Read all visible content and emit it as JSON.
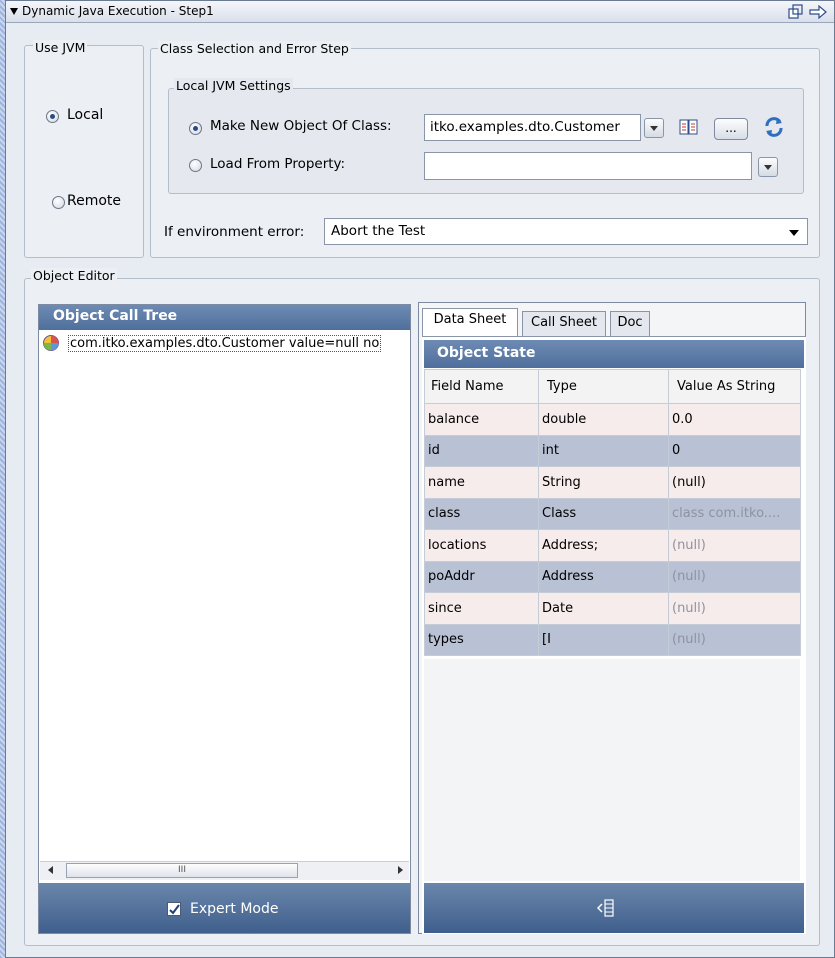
{
  "window": {
    "title": "Dynamic Java Execution - Step1"
  },
  "use_jvm": {
    "label": "Use JVM",
    "local_label": "Local",
    "remote_label": "Remote",
    "selected": "Local"
  },
  "class_selection": {
    "label": "Class Selection and Error Step",
    "local_jvm_settings": {
      "label": "Local JVM Settings",
      "make_new_label": "Make New Object Of Class:",
      "make_new_value": "itko.examples.dto.Customer",
      "load_from_label": "Load From Property:",
      "load_from_value": "",
      "ellipsis_label": "...",
      "selected": "Make New Object Of Class:"
    },
    "env_error_label": "If environment error:",
    "env_error_value": "Abort the Test"
  },
  "object_editor": {
    "label": "Object Editor",
    "call_tree": {
      "header": "Object Call Tree",
      "items": [
        "com.itko.examples.dto.Customer value=null no"
      ],
      "expert_mode_label": "Expert Mode",
      "expert_mode_checked": true
    },
    "tabs": [
      {
        "label": "Data Sheet",
        "selected": true
      },
      {
        "label": "Call Sheet"
      },
      {
        "label": "Doc"
      }
    ],
    "object_state": {
      "header": "Object State",
      "columns": [
        "Field Name",
        "Type",
        "Value As String"
      ],
      "rows": [
        {
          "field": "balance",
          "type": "double",
          "value": "0.0"
        },
        {
          "field": "id",
          "type": "int",
          "value": "0"
        },
        {
          "field": "name",
          "type": "String",
          "value": "(null)"
        },
        {
          "field": "class",
          "type": "Class",
          "value": "class com.itko...."
        },
        {
          "field": "locations",
          "type": "Address;",
          "value": "(null)"
        },
        {
          "field": "poAddr",
          "type": "Address",
          "value": "(null)"
        },
        {
          "field": "since",
          "type": "Date",
          "value": "(null)"
        },
        {
          "field": "types",
          "type": "[I",
          "value": "(null)"
        }
      ]
    }
  },
  "scrollbar": {
    "grip": "III"
  },
  "icons": {
    "collapse": "triangle-down-icon",
    "float": "float-window-icon",
    "export": "arrow-right-icon",
    "refresh": "refresh-icon",
    "class_browser": "class-browser-icon",
    "object": "object-icon",
    "column_config": "column-config-icon"
  }
}
